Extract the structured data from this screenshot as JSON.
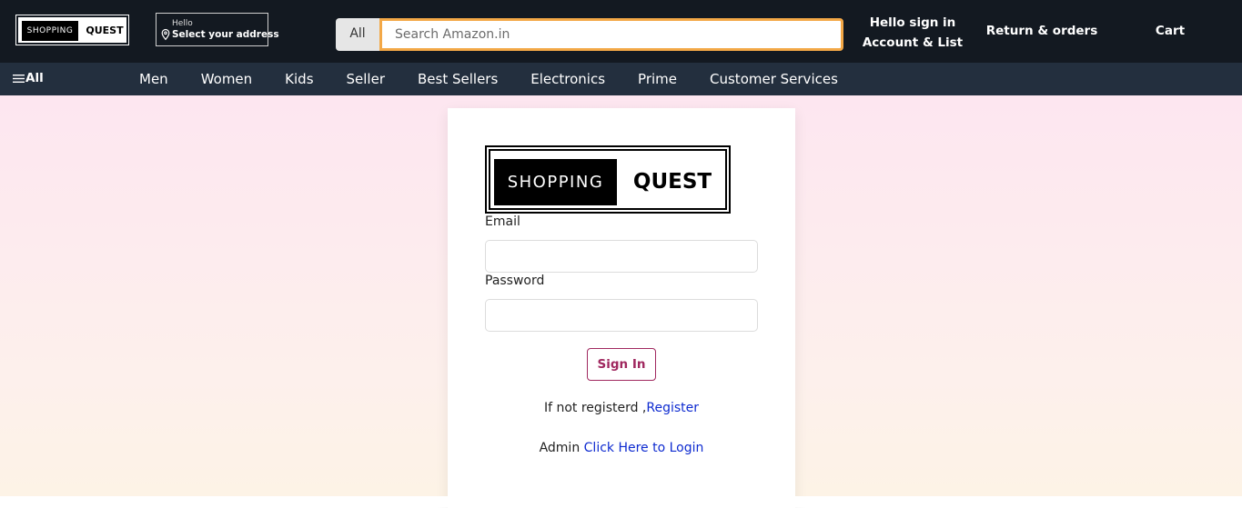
{
  "header": {
    "logo": {
      "left": "SHOPPING",
      "right": "QUEST"
    },
    "address": {
      "hello": "Hello",
      "select": "Select your address"
    },
    "search": {
      "category": "All",
      "placeholder": "Search Amazon.in"
    },
    "account": {
      "line1": "Hello sign in",
      "line2": "Account & List"
    },
    "returns": "Return & orders",
    "cart": "Cart"
  },
  "nav": {
    "all_label": "All",
    "items": [
      "Men",
      "Women",
      "Kids",
      "Seller",
      "Best Sellers",
      "Electronics",
      "Prime",
      "Customer Services"
    ]
  },
  "login": {
    "logo": {
      "left": "SHOPPING",
      "right": "QUEST"
    },
    "email_label": "Email",
    "email_value": "",
    "password_label": "Password",
    "password_value": "",
    "signin_label": "Sign In",
    "register_prefix": "If not registerd ,",
    "register_link": "Register",
    "admin_prefix": "Admin ",
    "admin_link": "Click Here to Login"
  },
  "colors": {
    "header_bg": "#131921",
    "nav_bg": "#232f3e",
    "search_border": "#f3a847",
    "signin_accent": "#a0285f",
    "link": "#0e2bd0"
  }
}
